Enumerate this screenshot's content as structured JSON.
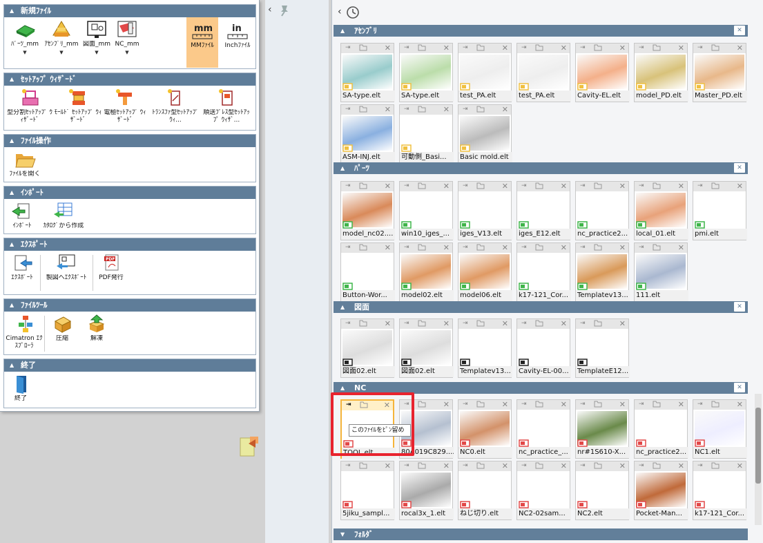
{
  "left_panel": {
    "sections": [
      {
        "title": "新規ﾌｧｲﾙ",
        "tools": [
          "ﾊﾟｰﾂ_mm",
          "ｱｾﾝﾌﾞﾘ_mm",
          "図面_mm",
          "NC_mm",
          "MMﾌｧｲﾙ",
          "Inchﾌｧｲﾙ"
        ],
        "mm_glyph": "mm",
        "in_glyph": "in"
      },
      {
        "title": "ｾｯﾄｱｯﾌﾟ ｳｨｻﾞｰﾄﾞ",
        "tools": [
          "型分割ｾｯﾄｱｯﾌﾟ ｳｨｻﾞｰﾄﾞ",
          "ﾓｰﾙﾄﾞ ｾｯﾄｱｯﾌﾟ ｳｨｻﾞｰﾄﾞ",
          "電極ｾｯﾄｱｯﾌﾟ ｳｨｻﾞｰﾄﾞ",
          "ﾄﾗﾝｽﾌｧ型ｾｯﾄｱｯﾌﾟ ｳｨ...",
          "順送ﾌﾟﾚｽ型ｾｯﾄｱｯﾌﾟ ｳｨｻﾞ..."
        ]
      },
      {
        "title": "ﾌｧｲﾙ操作",
        "tools": [
          "ﾌｧｲﾙを開く"
        ]
      },
      {
        "title": "ｲﾝﾎﾟｰﾄ",
        "tools": [
          "ｲﾝﾎﾟｰﾄ",
          "ｶﾀﾛｸﾞから作成"
        ]
      },
      {
        "title": "ｴｸｽﾎﾟｰﾄ",
        "tools": [
          "ｴｸｽﾎﾟｰﾄ",
          "製図へｴｸｽﾎﾟｰﾄ",
          "PDF発行"
        ],
        "pdf_glyph": "PDF"
      },
      {
        "title": "ﾌｧｲﾙﾂｰﾙ",
        "tools": [
          "Cimatron ｴｸｽﾌﾟﾛｰﾗ",
          "圧縮",
          "解凍"
        ]
      },
      {
        "title": "終了",
        "tools": [
          "終了"
        ]
      }
    ]
  },
  "right_panel": {
    "sections": [
      {
        "title": "ｱｾﾝﾌﾞﾘ",
        "files": [
          "SA-type.elt",
          "SA-type.elt",
          "test_PA.elt",
          "test_PA.elt",
          "Cavity-EL.elt",
          "model_PD.elt",
          "Master_PD.elt",
          "ASM-INJ.elt",
          "可動側_Basi...",
          "Basic mold.elt"
        ]
      },
      {
        "title": "ﾊﾟｰﾂ",
        "files": [
          "model_nc02....",
          "win10_iges_...",
          "iges_V13.elt",
          "iges_E12.elt",
          "nc_practice2...",
          "local_01.elt",
          "pmi.elt",
          "Button-Wor...",
          "model02.elt",
          "model06.elt",
          "k17-121_Cor...",
          "Templatev13...",
          "111.elt"
        ]
      },
      {
        "title": "図面",
        "files": [
          "図面02.elt",
          "図面02.elt",
          "Templatev13...",
          "Cavity-EL-00...",
          "TemplateE12..."
        ]
      },
      {
        "title": "NC",
        "files": [
          "TOOL.elt",
          "80A019C829....",
          "NC0.elt",
          "nc_practice_...",
          "nr#1S610-X...",
          "nc_practice2...",
          "NC1.elt",
          "5jiku_sampl...",
          "rocal3x_1.elt",
          "ねじ切り.elt",
          "NC2-02sam...",
          "NC2.elt",
          "Pocket-Man...",
          "k17-121_Cor..."
        ]
      },
      {
        "title": "ﾌｫﾙﾀﾞ",
        "files": []
      }
    ],
    "tooltip": "このﾌｧｲﾙをﾋﾟﾝ留め",
    "close_glyph": "✕",
    "pin_glyph": "⇥",
    "collapse_glyph": "▲",
    "expand_glyph": "▼",
    "back_glyph": "‹"
  }
}
